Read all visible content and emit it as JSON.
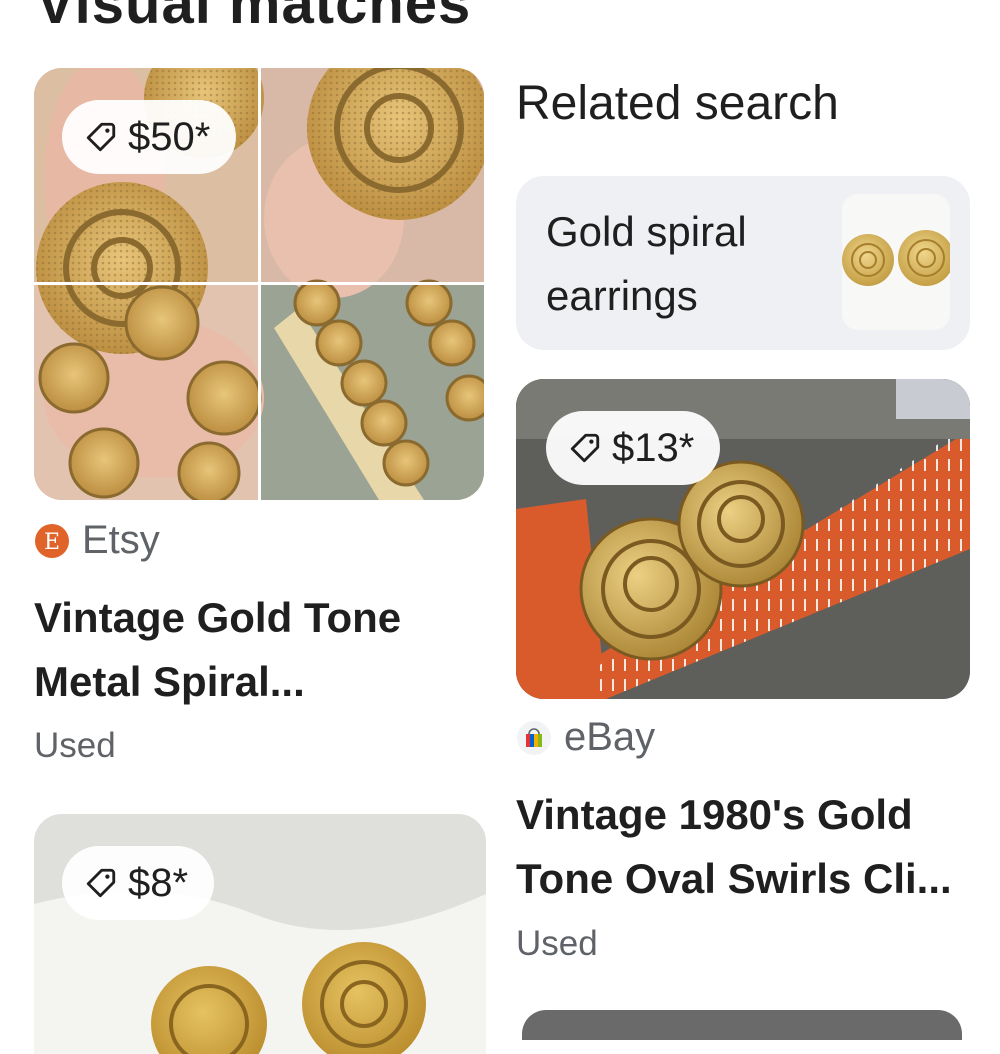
{
  "section": {
    "title": "Visual matches"
  },
  "related": {
    "heading": "Related search",
    "items": [
      {
        "label": "Gold spiral earrings"
      }
    ]
  },
  "results": [
    {
      "price": "$50*",
      "source": "Etsy",
      "source_icon": "etsy-logo-icon",
      "title": "Vintage Gold Tone Metal Spiral...",
      "condition": "Used"
    },
    {
      "price": "$13*",
      "source": "eBay",
      "source_icon": "ebay-shopping-bag-icon",
      "title": "Vintage 1980's Gold Tone Oval Swirls Cli...",
      "condition": "Used"
    },
    {
      "price": "$8*"
    }
  ],
  "colors": {
    "etsy_brand": "#e0632a",
    "gold": "#c9a24a",
    "chip_background": "#eef0f3",
    "secondary_text": "#5f6368",
    "ruler_orange": "#d95b2c"
  },
  "icons": [
    "price-tag-icon",
    "etsy-logo-icon",
    "ebay-shopping-bag-icon"
  ]
}
